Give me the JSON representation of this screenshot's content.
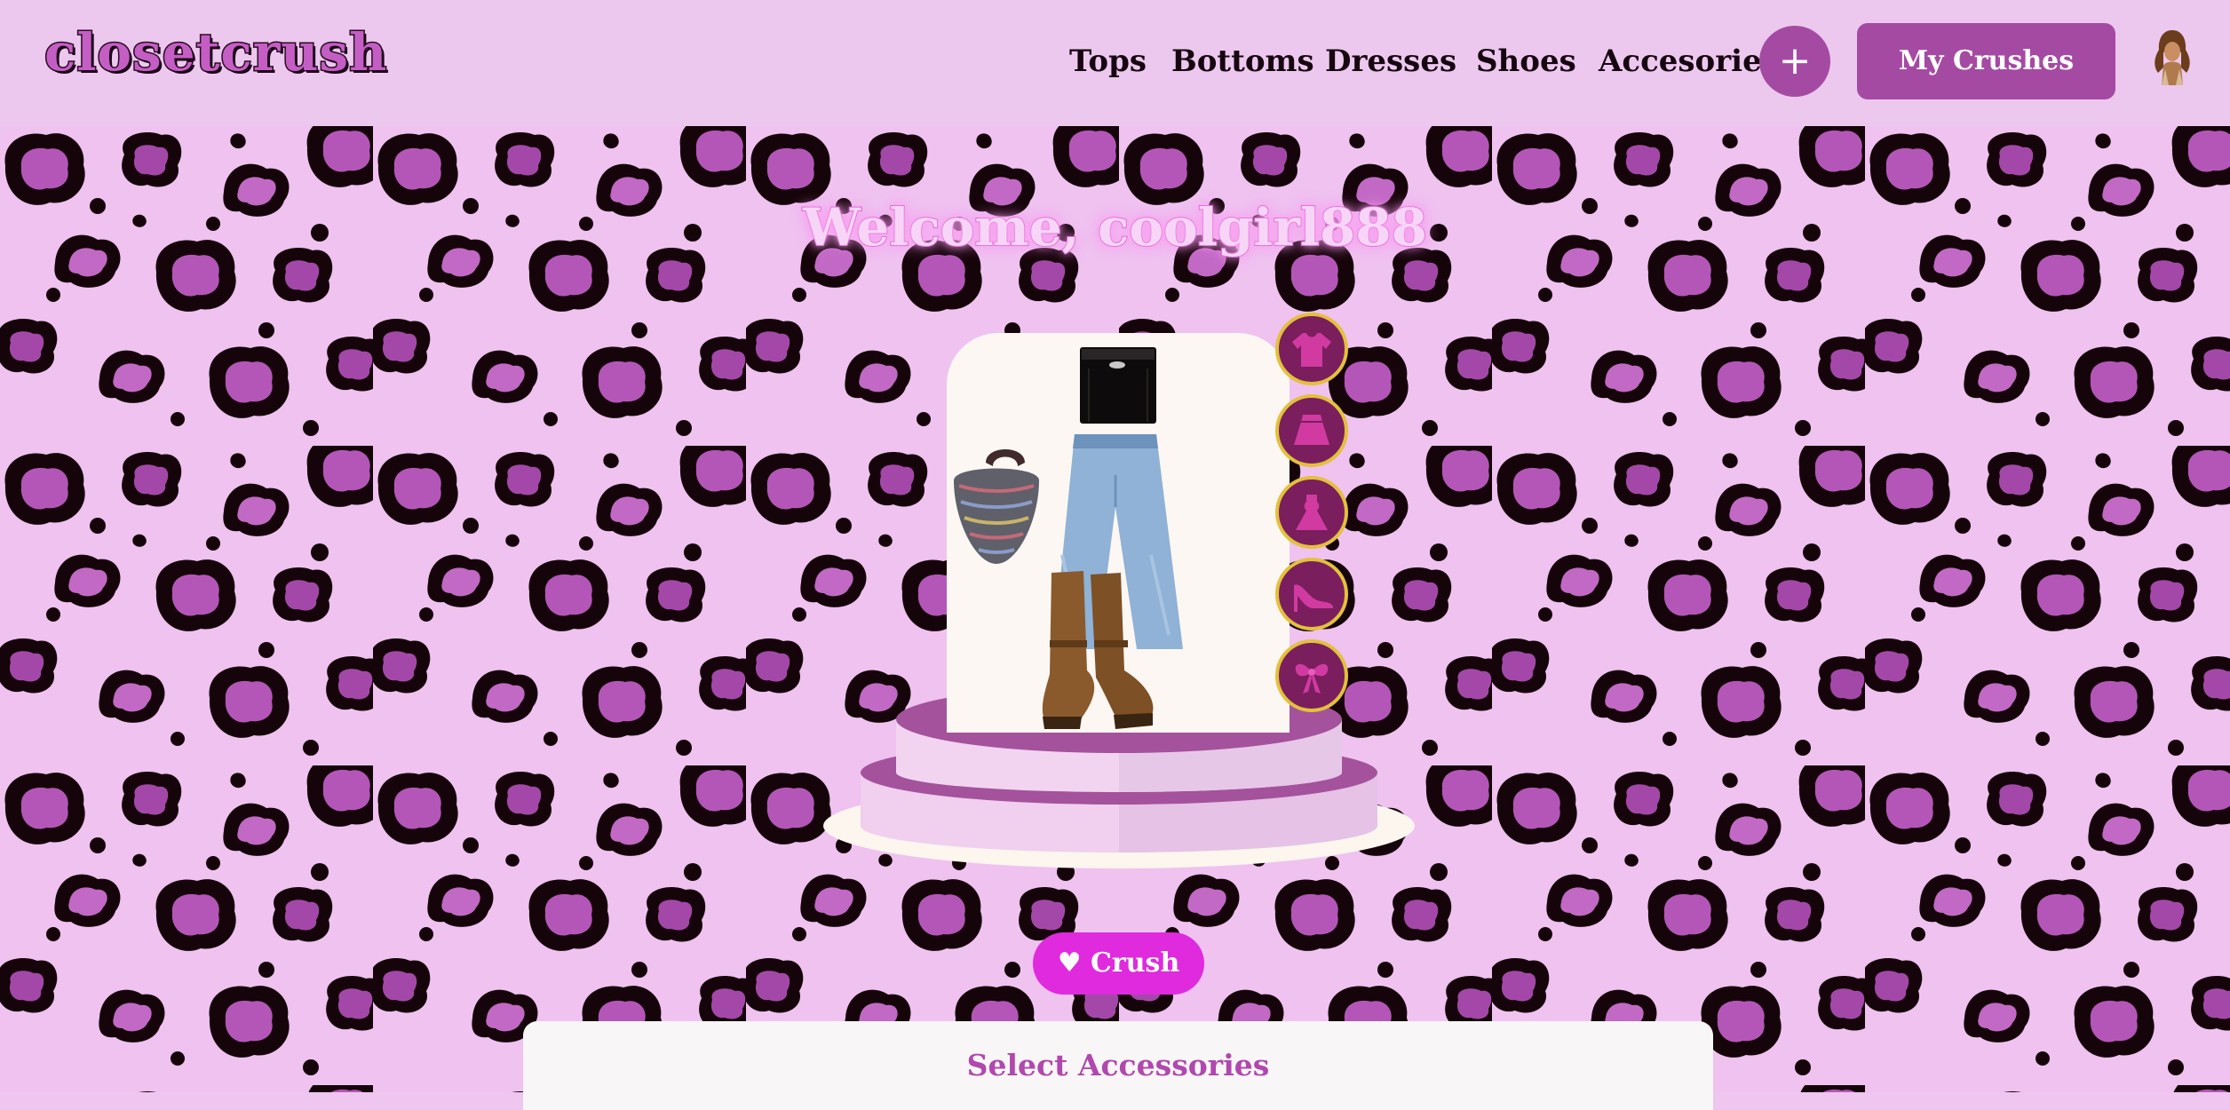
{
  "header": {
    "logo": "closetcrush",
    "nav": [
      "Tops",
      "Bottoms",
      "Dresses",
      "Shoes",
      "Accesories"
    ],
    "plus_label": "+",
    "crushes_label": "My Crushes"
  },
  "main": {
    "welcome": "Welcome, coolgirl888",
    "categories": [
      "tops-icon",
      "bottoms-icon",
      "dresses-icon",
      "shoes-icon",
      "accessories-icon"
    ],
    "crush_label": "♥ Crush",
    "panel_title": "Select Accessories"
  },
  "colors": {
    "header_bg": "#ecc8ee",
    "accent": "#a54aa3",
    "crush_pink": "#e02ade",
    "leopard_bg": "#efc2f0",
    "spot_fill": "#b456b8",
    "spot_ring": "#150409"
  }
}
